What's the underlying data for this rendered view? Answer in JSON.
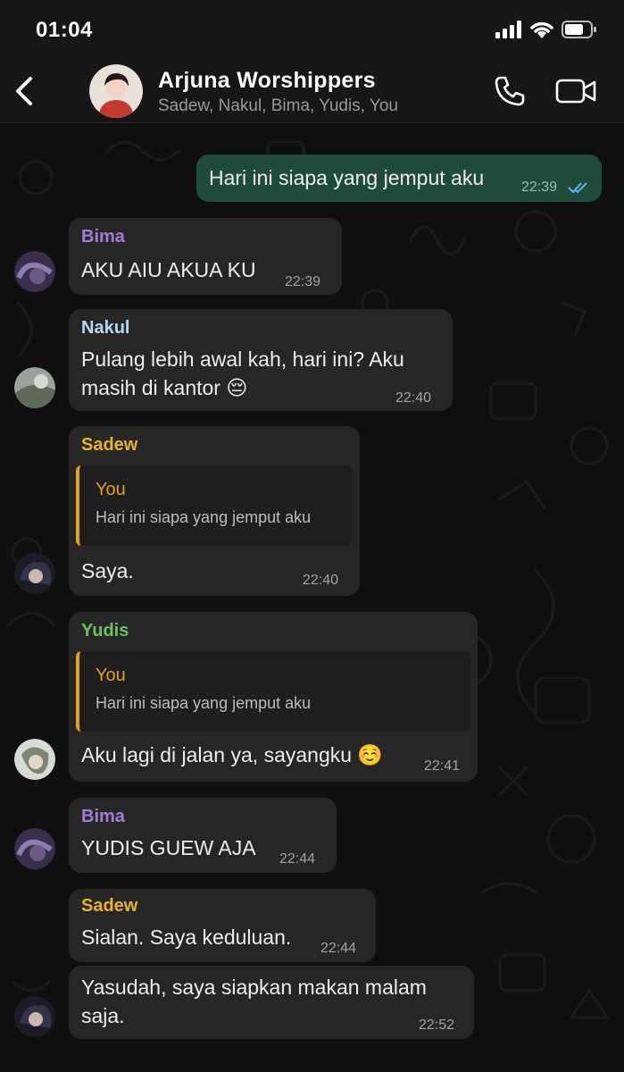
{
  "status_bar": {
    "time": "01:04"
  },
  "header": {
    "title": "Arjuna Worshippers",
    "members": "Sadew, Nakul, Bima, Yudis, You",
    "back_icon": "chevron-left-icon",
    "call_icon": "phone-icon",
    "video_icon": "video-camera-icon"
  },
  "colors": {
    "bima": "#a47cd6",
    "nakul": "#b9d7f2",
    "sadew": "#e8b420",
    "yudis": "#6fbf5c",
    "quote_you": "#e0a318",
    "outgoing_bubble": "#1f4b3b",
    "incoming_bubble": "#262626",
    "read_ticks": "#5fb4f0"
  },
  "messages": [
    {
      "direction": "out",
      "text": "Hari ini siapa yang jemput aku",
      "time": "22:39",
      "status": "read"
    },
    {
      "direction": "in",
      "sender": "Bima",
      "text": "AKU AIU AKUA KU",
      "time": "22:39"
    },
    {
      "direction": "in",
      "sender": "Nakul",
      "text_line1": "Pulang lebih awal kah, hari ini? Aku",
      "text_line2": "masih di kantor 😔",
      "time": "22:40"
    },
    {
      "direction": "in",
      "sender": "Sadew",
      "quote": {
        "name": "You",
        "text": "Hari ini siapa yang jemput aku"
      },
      "text": "Saya.",
      "time": "22:40"
    },
    {
      "direction": "in",
      "sender": "Yudis",
      "quote": {
        "name": "You",
        "text": "Hari ini siapa yang jemput aku"
      },
      "text": "Aku lagi di jalan ya, sayangku ☺️",
      "time": "22:41"
    },
    {
      "direction": "in",
      "sender": "Bima",
      "text": "YUDIS GUEW AJA",
      "time": "22:44"
    },
    {
      "direction": "in",
      "sender": "Sadew",
      "text": "Sialan. Saya keduluan.",
      "time": "22:44"
    },
    {
      "direction": "in",
      "text_line1": "Yasudah, saya siapkan makan malam",
      "text_line2": "saja.",
      "time": "22:52"
    }
  ]
}
